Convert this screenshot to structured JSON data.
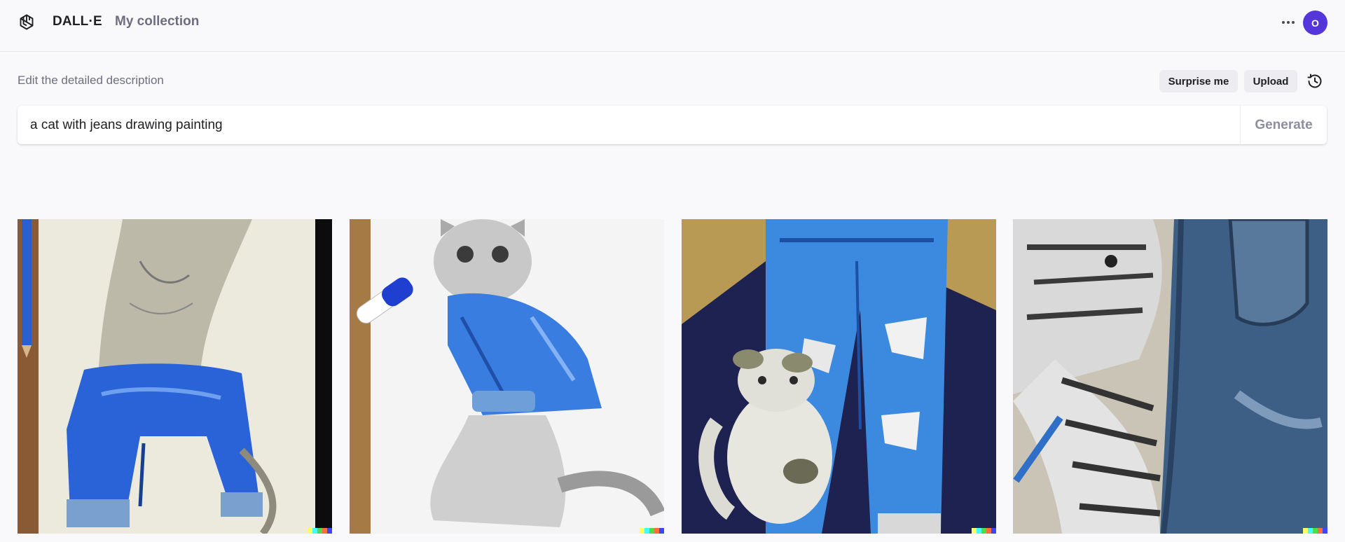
{
  "header": {
    "logo_icon": "openai-logo-icon",
    "brand": "DALL·E",
    "nav_collection": "My collection",
    "more_icon": "more-dots-icon",
    "avatar_initial": "O",
    "avatar_color": "#5436da"
  },
  "prompt": {
    "label": "Edit the detailed description",
    "surprise_label": "Surprise me",
    "upload_label": "Upload",
    "history_icon": "history-icon",
    "value": "a cat with jeans drawing painting",
    "generate_label": "Generate"
  },
  "results": [
    {
      "description": "Pencil drawing of a cat wearing blue jeans, blue pencil at left"
    },
    {
      "description": "Sketched grey cat in a blue denim jacket next to a blue marker"
    },
    {
      "description": "Painted cat sitting in front of ripped blue jeans on cardboard"
    },
    {
      "description": "Striped cat drawing next to a denim jeans leg with pocket"
    }
  ],
  "signature_colors": [
    "#ffff66",
    "#42ffff",
    "#51da4c",
    "#ff6e3c",
    "#3c46ff"
  ]
}
